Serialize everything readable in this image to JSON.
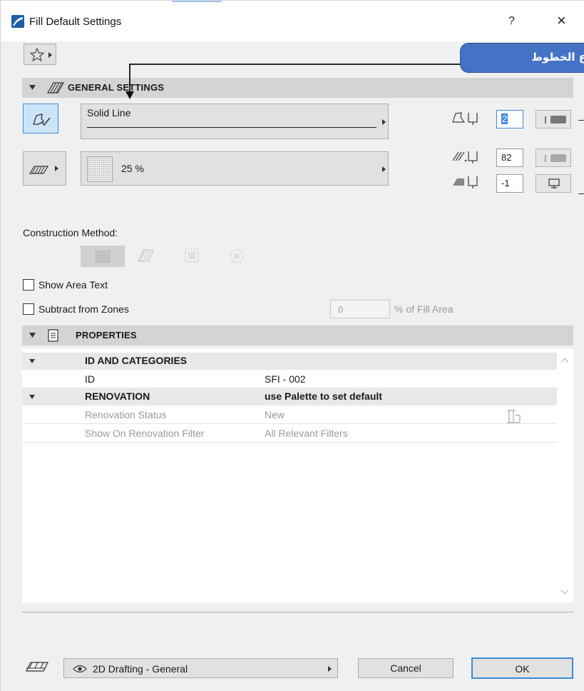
{
  "window": {
    "title": "Fill Default Settings",
    "help_label": "?",
    "close_label": "×"
  },
  "general": {
    "section_title": "GENERAL SETTINGS",
    "line_type": "Solid Line",
    "fill_percent": "25 %",
    "pen_contour": "2",
    "pen_foreground": "82",
    "pen_background": "-1"
  },
  "construction": {
    "label": "Construction Method:"
  },
  "options": {
    "show_area_text": "Show Area Text",
    "subtract_from_zones": "Subtract from Zones",
    "subtract_value": "0",
    "subtract_suffix": "% of Fill Area"
  },
  "properties": {
    "section_title": "PROPERTIES",
    "rows": [
      {
        "name": "ID AND CATEGORIES",
        "value": ""
      },
      {
        "name": "ID",
        "value": "SFI - 002"
      },
      {
        "name": "RENOVATION",
        "value": "use Palette to set default"
      },
      {
        "name": "Renovation Status",
        "value": "New"
      },
      {
        "name": "Show On Renovation Filter",
        "value": "All Relevant Filters"
      }
    ]
  },
  "footer": {
    "layer": "2D Drafting - General",
    "cancel": "Cancel",
    "ok": "OK"
  },
  "annotation": {
    "callout_text": "ع الخطوط"
  },
  "colors": {
    "accent": "#4472c4",
    "selected_button_bg": "#cce4f7",
    "section_bar": "#d4d4d4"
  }
}
